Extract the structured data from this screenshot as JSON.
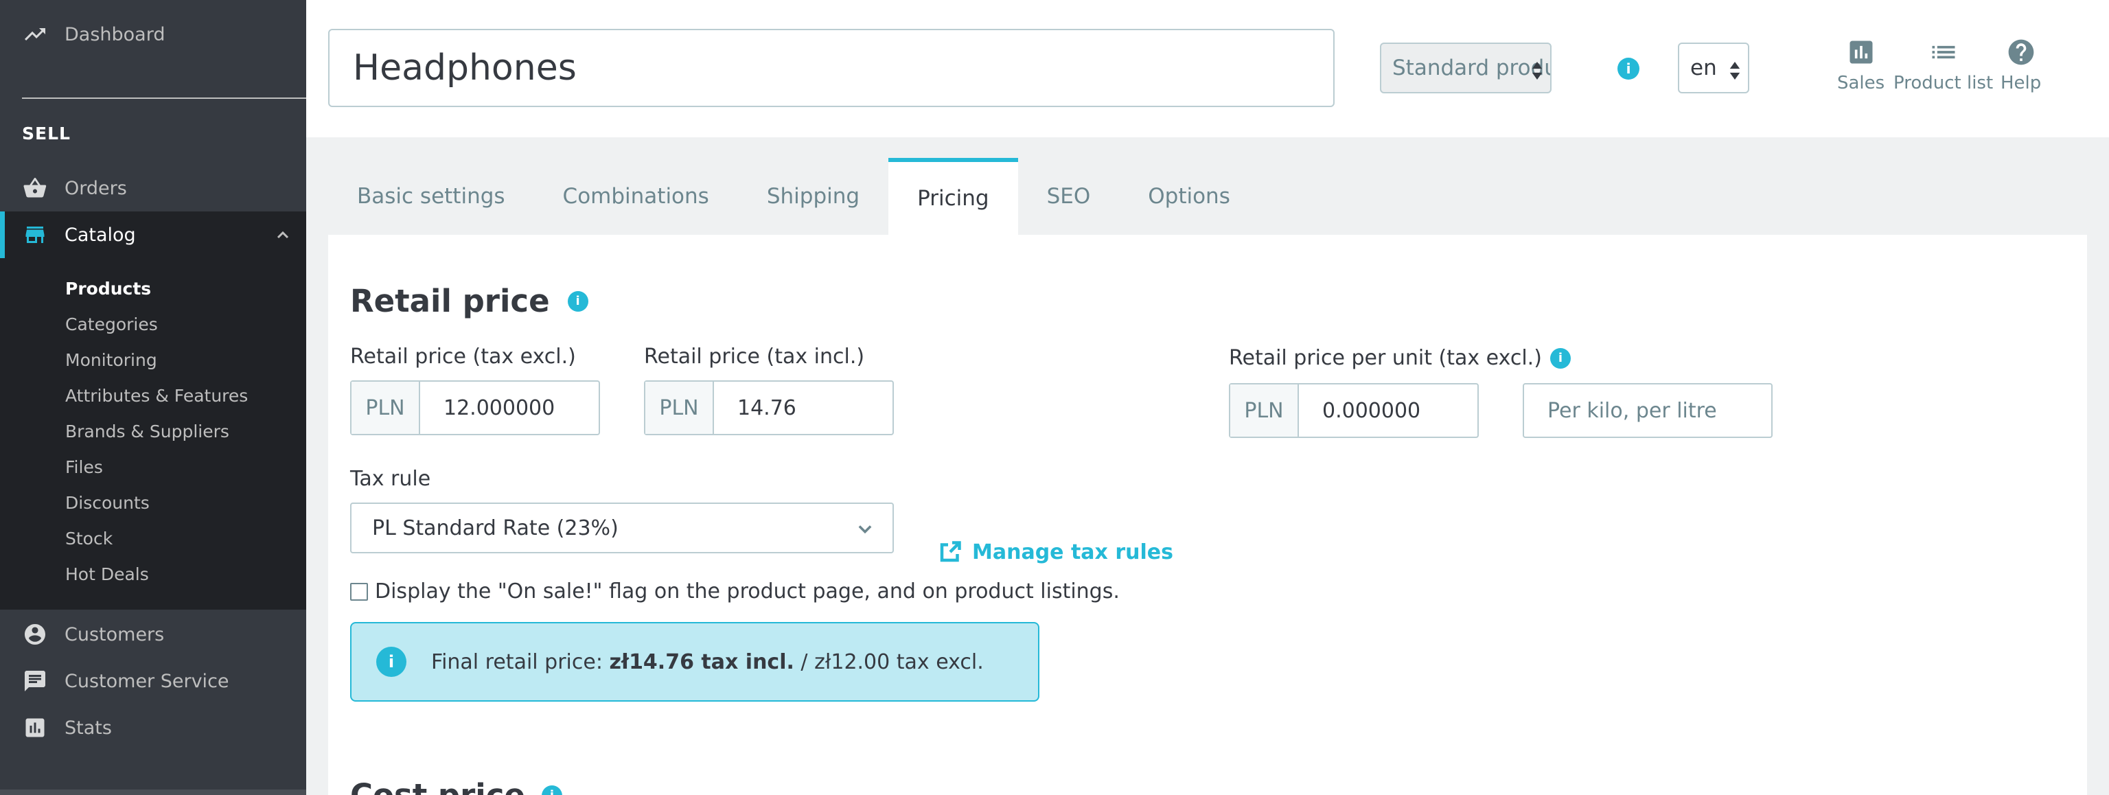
{
  "sidebar": {
    "dashboard": "Dashboard",
    "section_sell": "SELL",
    "orders": "Orders",
    "catalog": "Catalog",
    "submenu": [
      "Products",
      "Categories",
      "Monitoring",
      "Attributes & Features",
      "Brands & Suppliers",
      "Files",
      "Discounts",
      "Stock",
      "Hot Deals"
    ],
    "customers": "Customers",
    "customer_service": "Customer Service",
    "stats": "Stats"
  },
  "header": {
    "product_name": "Headphones",
    "product_type": "Standard product",
    "language": "en",
    "actions": {
      "sales": "Sales",
      "product_list": "Product list",
      "help": "Help"
    }
  },
  "tabs": [
    "Basic settings",
    "Combinations",
    "Shipping",
    "Pricing",
    "SEO",
    "Options"
  ],
  "pricing": {
    "retail_price_title": "Retail price",
    "tax_excl_label": "Retail price (tax excl.)",
    "tax_excl_currency": "PLN",
    "tax_excl_value": "12.000000",
    "tax_incl_label": "Retail price (tax incl.)",
    "tax_incl_currency": "PLN",
    "tax_incl_value": "14.76",
    "per_unit_label": "Retail price per unit (tax excl.)",
    "per_unit_currency": "PLN",
    "per_unit_value": "0.000000",
    "per_unit_placeholder": "Per kilo, per litre",
    "tax_rule_label": "Tax rule",
    "tax_rule_value": "PL Standard Rate (23%)",
    "manage_tax_rules": "Manage tax rules",
    "on_sale_label": "Display the \"On sale!\" flag on the product page, and on product listings.",
    "final_price_prefix": "Final retail price: ",
    "final_price_incl": "zł14.76 tax incl.",
    "final_price_sep": " / ",
    "final_price_excl": "zł12.00 tax excl.",
    "cost_price_title": "Cost price"
  },
  "colors": {
    "accent": "#25b9d7",
    "sidebar_bg": "#363a41",
    "sidebar_active_bg": "#202226"
  }
}
